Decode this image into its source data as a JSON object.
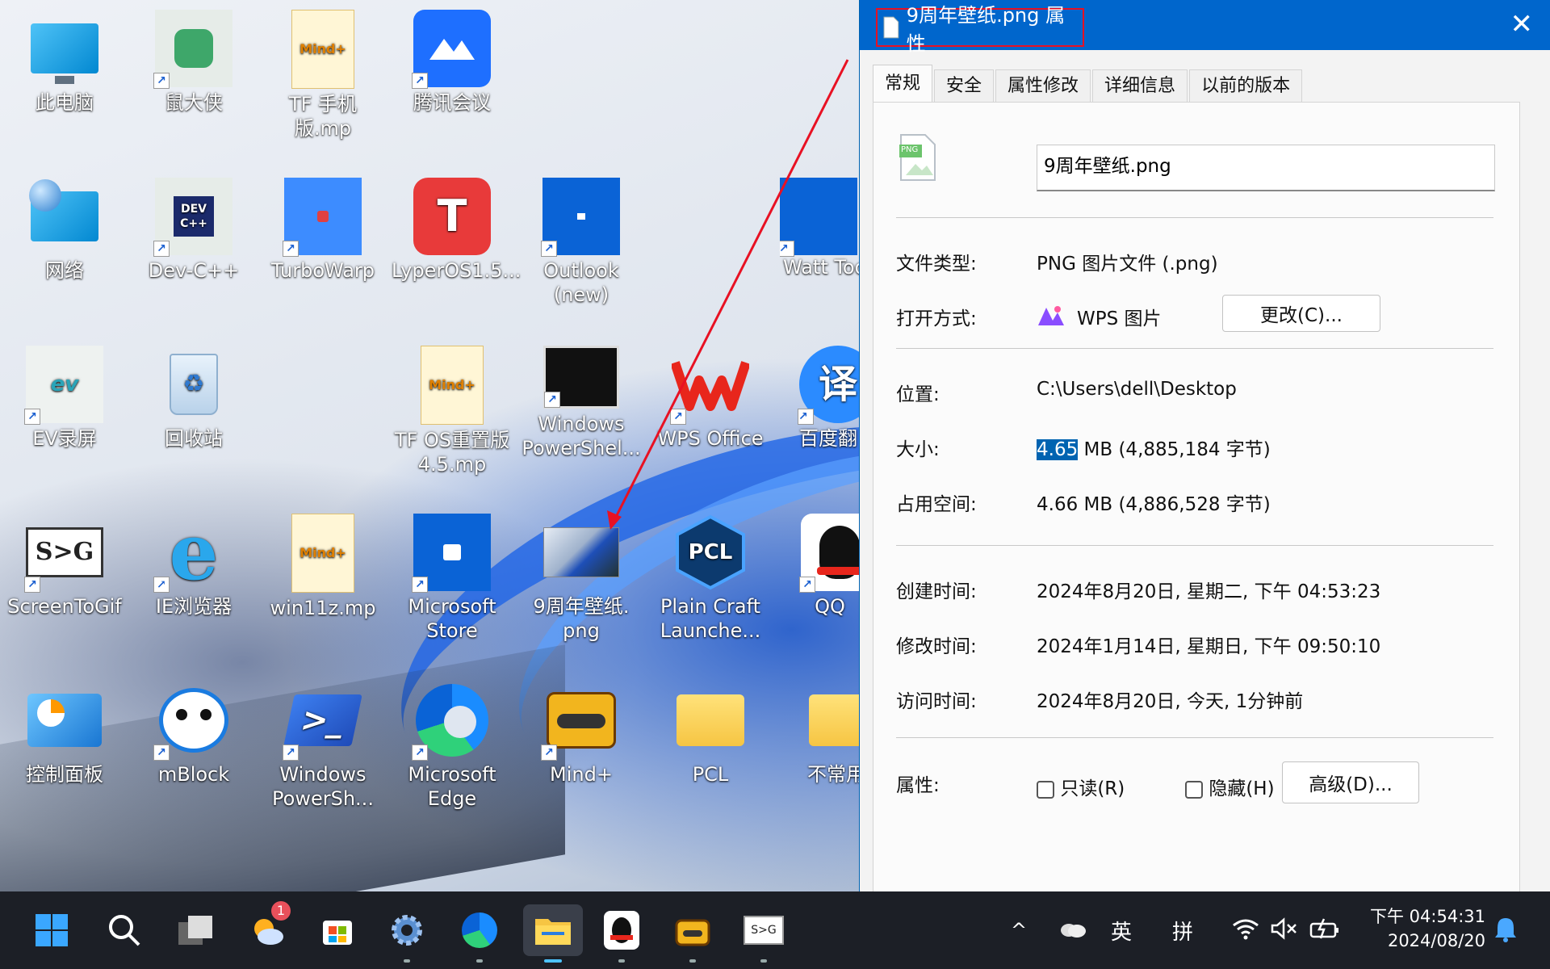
{
  "desktop": {
    "icons": [
      {
        "label": "此电脑"
      },
      {
        "label": "鼠大侠"
      },
      {
        "label": "TF 手机版.mp"
      },
      {
        "label": "腾讯会议"
      },
      {
        "label": "网络"
      },
      {
        "label": "Dev-C++"
      },
      {
        "label": "TurboWarp"
      },
      {
        "label": "LyperOS1.5..."
      },
      {
        "label": "Outlook\n(new)"
      },
      {
        "label": "Watt Too"
      },
      {
        "label": "EV录屏"
      },
      {
        "label": "回收站"
      },
      {
        "label": "TF  OS重置版\n4.5.mp"
      },
      {
        "label": "Windows\nPowerShel..."
      },
      {
        "label": "WPS Office"
      },
      {
        "label": "百度翻"
      },
      {
        "label": "ScreenToGif"
      },
      {
        "label": "IE浏览器"
      },
      {
        "label": "win11z.mp"
      },
      {
        "label": "Microsoft\nStore"
      },
      {
        "label": "9周年壁纸.\npng"
      },
      {
        "label": "Plain Craft\nLaunche..."
      },
      {
        "label": "QQ"
      },
      {
        "label": "控制面板"
      },
      {
        "label": "mBlock"
      },
      {
        "label": "Windows\nPowerSh..."
      },
      {
        "label": "Microsoft\nEdge"
      },
      {
        "label": "Mind+"
      },
      {
        "label": "PCL"
      },
      {
        "label": "不常用"
      }
    ],
    "glyphs": {
      "mind": "Mind+",
      "devc": "DEV\nC++",
      "pcl": "PCL",
      "stog": "S>G",
      "yi": "译",
      "ev": "ev",
      "png": "PNG"
    }
  },
  "dialog": {
    "title": "9周年壁纸.png 属性",
    "close": "✕",
    "tabs": [
      "常规",
      "安全",
      "属性修改",
      "详细信息",
      "以前的版本"
    ],
    "filename": "9周年壁纸.png",
    "file_type_label": "文件类型:",
    "file_type_value": "PNG 图片文件 (.png)",
    "open_with_label": "打开方式:",
    "open_with_value": "WPS 图片",
    "change_button": "更改(C)...",
    "location_label": "位置:",
    "location_value": "C:\\Users\\dell\\Desktop",
    "size_label": "大小:",
    "size_selected": "4.65",
    "size_rest": " MB (4,885,184 字节)",
    "disk_size_label": "占用空间:",
    "disk_size_value": "4.66 MB (4,886,528 字节)",
    "created_label": "创建时间:",
    "created_value": "2024年8月20日, 星期二, 下午 04:53:23",
    "modified_label": "修改时间:",
    "modified_value": "2024年1月14日, 星期日, 下午 09:50:10",
    "accessed_label": "访问时间:",
    "accessed_value": "2024年8月20日, 今天, 1分钟前",
    "attributes_label": "属性:",
    "readonly_label": "只读(R)",
    "hidden_label": "隐藏(H)",
    "advanced_button": "高级(D)..."
  },
  "taskbar": {
    "weather_badge": "1",
    "tray_chevron": "^",
    "ime_lang": "英",
    "ime_mode": "拼",
    "time": "下午 04:54:31",
    "date": "2024/08/20"
  },
  "colors": {
    "accent": "#0066cc",
    "annotation": "#e81123"
  }
}
